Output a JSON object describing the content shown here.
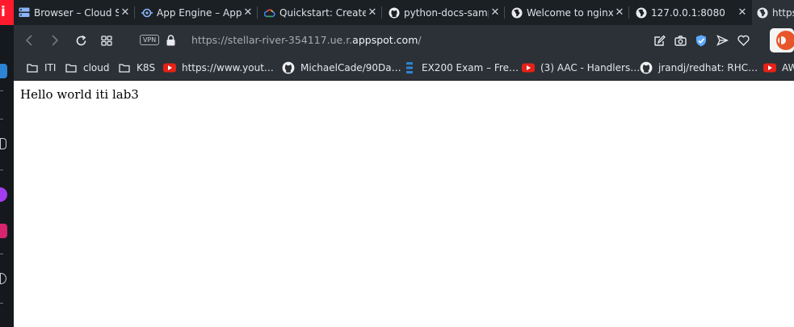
{
  "tabs": [
    {
      "title": "Browser – Cloud S",
      "icon": "server-icon"
    },
    {
      "title": "App Engine – App",
      "icon": "app-engine-icon"
    },
    {
      "title": "Quickstart: Create",
      "icon": "google-cloud-icon"
    },
    {
      "title": "python-docs-samp",
      "icon": "github-icon"
    },
    {
      "title": "Welcome to nginx",
      "icon": "globe-icon"
    },
    {
      "title": "127.0.0.1:8080",
      "icon": "globe-icon"
    },
    {
      "title": "https",
      "icon": "globe-icon",
      "active": true
    }
  ],
  "toolbar": {
    "vpn_label": "VPN",
    "url_prefix": "https://stellar-river-354117.ue.r.",
    "url_domain": "appspot.com",
    "url_suffix": "/"
  },
  "bookmarks": [
    {
      "label": "ITI",
      "icon": "folder-icon"
    },
    {
      "label": "cloud",
      "icon": "folder-icon"
    },
    {
      "label": "K8S",
      "icon": "folder-icon"
    },
    {
      "label": "https://www.yout…",
      "icon": "youtube-icon"
    },
    {
      "label": "MichaelCade/90Da…",
      "icon": "github-icon"
    },
    {
      "label": "EX200 Exam – Fre…",
      "icon": "stack-icon"
    },
    {
      "label": "(3) AAC - Handlers…",
      "icon": "youtube-icon"
    },
    {
      "label": "jrandj/redhat: RHC…",
      "icon": "github-icon"
    },
    {
      "label": "AW",
      "icon": "youtube-icon"
    }
  ],
  "page": {
    "body_text": "Hello world iti lab3"
  },
  "colors": {
    "sidebar_bg": "#15191e",
    "tabstrip_bg": "#1b2025",
    "toolbar_bg": "#2b3137",
    "brand_red": "#ff1b2d",
    "youtube_red": "#e62117"
  }
}
